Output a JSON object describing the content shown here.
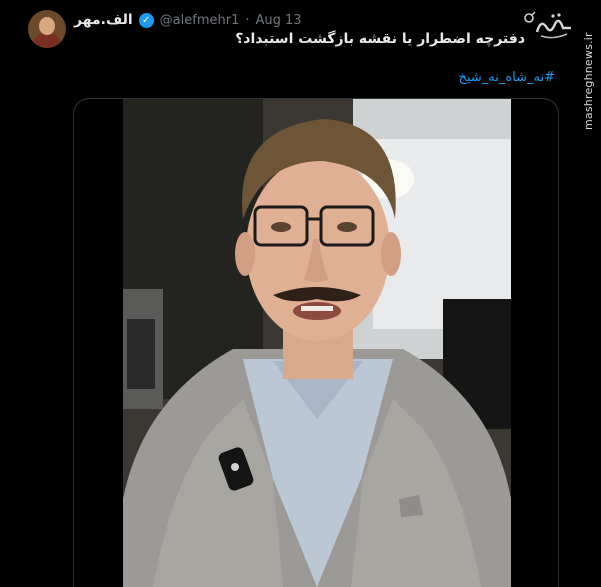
{
  "tweet": {
    "author_name": "الف.مهر",
    "handle": "@alefmehr1",
    "separator": "·",
    "date": "Aug 13",
    "text": "دفترچه اضطرار یا نقشه بازگشت استبداد؟",
    "hashtag": "#نه_شاه_نه_شیخ"
  },
  "watermark": {
    "site": "mashreghnews.ir",
    "logo_icon": "mashregh-logo"
  },
  "icons": {
    "verified": "verified-badge-icon"
  },
  "colors": {
    "background": "#000000",
    "text": "#e7e9ea",
    "secondary": "#71767b",
    "link": "#1d9bf0",
    "border": "#2f3336"
  }
}
